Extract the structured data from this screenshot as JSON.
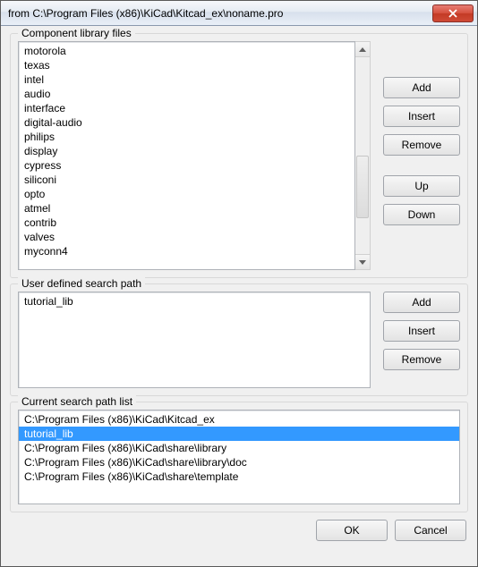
{
  "window": {
    "title": "from C:\\Program Files (x86)\\KiCad\\Kitcad_ex\\noname.pro"
  },
  "libs": {
    "label": "Component library files",
    "items": [
      "motorola",
      "texas",
      "intel",
      "audio",
      "interface",
      "digital-audio",
      "philips",
      "display",
      "cypress",
      "siliconi",
      "opto",
      "atmel",
      "contrib",
      "valves",
      "myconn4"
    ],
    "buttons": {
      "add": "Add",
      "insert": "Insert",
      "remove": "Remove",
      "up": "Up",
      "down": "Down"
    }
  },
  "usp": {
    "label": "User defined search path",
    "items": [
      "tutorial_lib"
    ],
    "buttons": {
      "add": "Add",
      "insert": "Insert",
      "remove": "Remove"
    }
  },
  "csp": {
    "label": "Current search path list",
    "items": [
      "C:\\Program Files (x86)\\KiCad\\Kitcad_ex",
      "tutorial_lib",
      "C:\\Program Files (x86)\\KiCad\\share\\library",
      "C:\\Program Files (x86)\\KiCad\\share\\library\\doc",
      "C:\\Program Files (x86)\\KiCad\\share\\template"
    ],
    "selected_index": 1
  },
  "footer": {
    "ok": "OK",
    "cancel": "Cancel"
  }
}
